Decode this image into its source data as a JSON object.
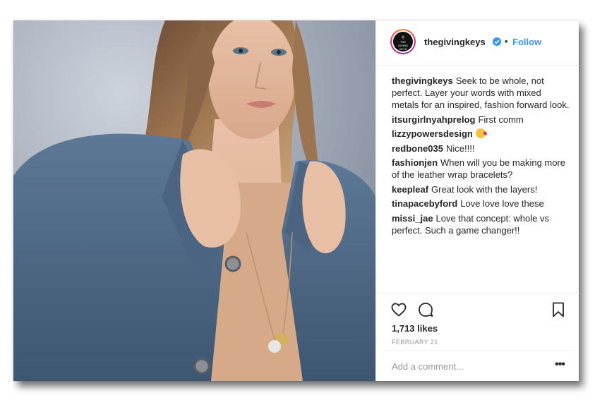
{
  "post": {
    "image_alt": "Woman in a denim jacket wearing layered necklaces with gold and silver discs",
    "account": {
      "avatar_text_line1": "THE",
      "avatar_text_line2": "GIVING",
      "avatar_text_line3": "KEYS",
      "username": "thegivingkeys",
      "verified_icon": "verified-badge-icon",
      "separator": "•",
      "follow_label": "Follow"
    },
    "comments": [
      {
        "user": "thegivingkeys",
        "text": "Seek to be whole, not perfect. Layer your words with mixed metals for an inspired, fashion forward look."
      },
      {
        "user": "itsurgirlnyahprelog",
        "text": "First comm"
      },
      {
        "user": "lizzypowersdesign",
        "text": "",
        "emoji": "kissing-face-icon"
      },
      {
        "user": "redbone035",
        "text": "Nice!!!!"
      },
      {
        "user": "fashionjen",
        "text": "When will you be making more of the leather wrap bracelets?"
      },
      {
        "user": "keepleaf",
        "text": "Great look with the layers!"
      },
      {
        "user": "tinapacebyford",
        "text": "Love love love these"
      },
      {
        "user": "missi_jae",
        "text": "Love that concept: whole vs perfect. Such a game changer!!"
      }
    ],
    "likes": "1,713 likes",
    "date": "FEBRUARY 21",
    "add_comment_placeholder": "Add a comment...",
    "more_label": "•••",
    "colors": {
      "link": "#3897f0",
      "text": "#262626",
      "muted": "#999999",
      "border": "#efefef"
    }
  }
}
